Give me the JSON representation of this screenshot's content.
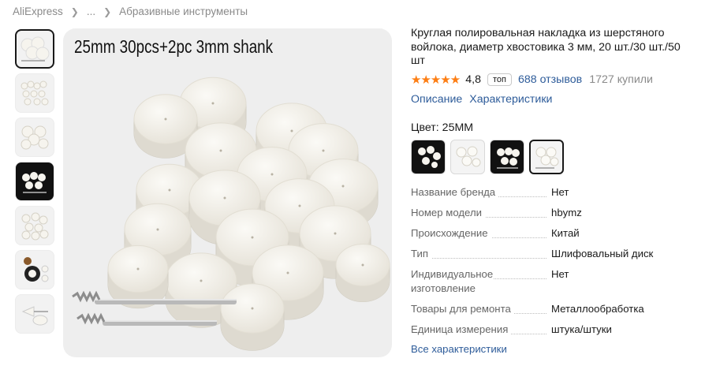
{
  "breadcrumb": {
    "items": [
      "AliExpress",
      "...",
      "Абразивные инструменты"
    ]
  },
  "gallery": {
    "caption": "25mm 30pcs+2pc 3mm shank",
    "thumbnails": [
      "felt-wheels-pile",
      "felt-set-many",
      "felt-wheels-set",
      "felt-on-dark",
      "felt-small-pile",
      "felt-infographic",
      "felt-cones"
    ]
  },
  "product": {
    "title": "Круглая полировальная накладка из шерстяного войлока, диаметр хвостовика 3 мм, 20 шт./30 шт./50 шт",
    "stars": "★★★★★",
    "rating": "4,8",
    "badge": "топ",
    "reviews": "688 отзывов",
    "sold": "1727 купили",
    "links": [
      "Описание",
      "Характеристики"
    ],
    "color_label": "Цвет: 25ММ"
  },
  "specs": [
    {
      "name": "Название бренда",
      "value": "Нет"
    },
    {
      "name": "Номер модели",
      "value": "hbymz"
    },
    {
      "name": "Происхождение",
      "value": "Китай"
    },
    {
      "name": "Тип",
      "value": "Шлифовальный диск"
    },
    {
      "name": "Индивидуальное изготовление",
      "value": "Нет"
    },
    {
      "name": "Товары для ремонта",
      "value": "Металлообработка"
    },
    {
      "name": "Единица измерения",
      "value": "штука/штуки"
    }
  ],
  "all_specs_link": "Все характеристики",
  "colors": {
    "accent_link": "#2e5c9a",
    "stars": "#fd7e14",
    "felt": "#f6f4ee"
  }
}
